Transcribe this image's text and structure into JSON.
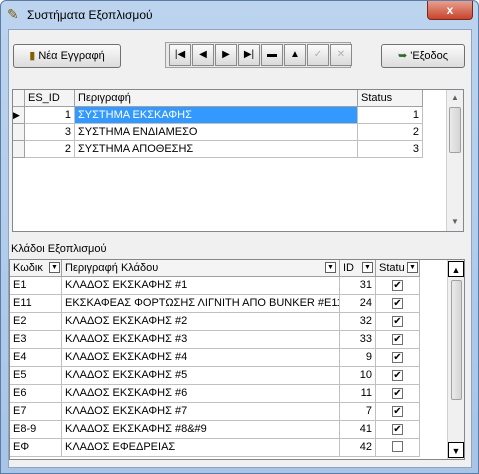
{
  "window": {
    "title": "Συστήματα Εξοπλισμού",
    "close_glyph": "x"
  },
  "toolbar": {
    "new_label": "Νέα Εγγραφή",
    "exit_label": "'Εξοδος"
  },
  "navigator": {
    "first": "first-record",
    "prev": "prior-record",
    "next": "next-record",
    "last": "last-record",
    "delete": "delete-record",
    "insert": "insert-record",
    "post": "post-edit",
    "cancel": "cancel-edit"
  },
  "systems_grid": {
    "columns": [
      "ES_ID",
      "Περιγραφή",
      "Status"
    ],
    "rows": [
      {
        "id": "1",
        "desc": "ΣΥΣΤΗΜΑ ΕΚΣΚΑΦΗΣ",
        "status": "1"
      },
      {
        "id": "3",
        "desc": "ΣΥΣΤΗΜΑ ΕΝΔΙΑΜΕΣΟ",
        "status": "2"
      },
      {
        "id": "2",
        "desc": "ΣΥΣΤΗΜΑ ΑΠΟΘΕΣΗΣ",
        "status": "3"
      }
    ]
  },
  "branches": {
    "section_label": "Κλάδοι Εξοπλισμού",
    "columns": [
      "Κωδικ",
      "Περιγραφή Κλάδου",
      "ID",
      "Statu"
    ],
    "rows": [
      {
        "code": "E1",
        "desc": "ΚΛΑΔΟΣ ΕΚΣΚΑΦΗΣ #1",
        "id": "31",
        "checked": true
      },
      {
        "code": "E11",
        "desc": "ΕΚΣΚΑΦΕΑΣ ΦΟΡΤΩΣΗΣ ΛΙΓΝΙΤΗ ΑΠΟ BUNKER #E11",
        "id": "24",
        "checked": true
      },
      {
        "code": "E2",
        "desc": "ΚΛΑΔΟΣ ΕΚΣΚΑΦΗΣ #2",
        "id": "32",
        "checked": true
      },
      {
        "code": "E3",
        "desc": "ΚΛΑΔΟΣ ΕΚΣΚΑΦΗΣ #3",
        "id": "33",
        "checked": true
      },
      {
        "code": "E4",
        "desc": "ΚΛΑΔΟΣ ΕΚΣΚΑΦΗΣ #4",
        "id": "9",
        "checked": true
      },
      {
        "code": "E5",
        "desc": "ΚΛΑΔΟΣ ΕΚΣΚΑΦΗΣ #5",
        "id": "10",
        "checked": true
      },
      {
        "code": "E6",
        "desc": "ΚΛΑΔΟΣ ΕΚΣΚΑΦΗΣ #6",
        "id": "11",
        "checked": true
      },
      {
        "code": "E7",
        "desc": "ΚΛΑΔΟΣ ΕΚΣΚΑΦΗΣ #7",
        "id": "7",
        "checked": true
      },
      {
        "code": "E8-9",
        "desc": "ΚΛΑΔΟΣ ΕΚΣΚΑΦΗΣ #8&#9",
        "id": "41",
        "checked": true
      },
      {
        "code": "EΦ",
        "desc": "ΚΛΑΔΟΣ ΕΦΕΔΡΕΙΑΣ",
        "id": "42",
        "checked": false
      }
    ]
  },
  "colors": {
    "selection": "#3399ff",
    "title_bar": "#bcd4ee",
    "close_button": "#c8442c"
  }
}
